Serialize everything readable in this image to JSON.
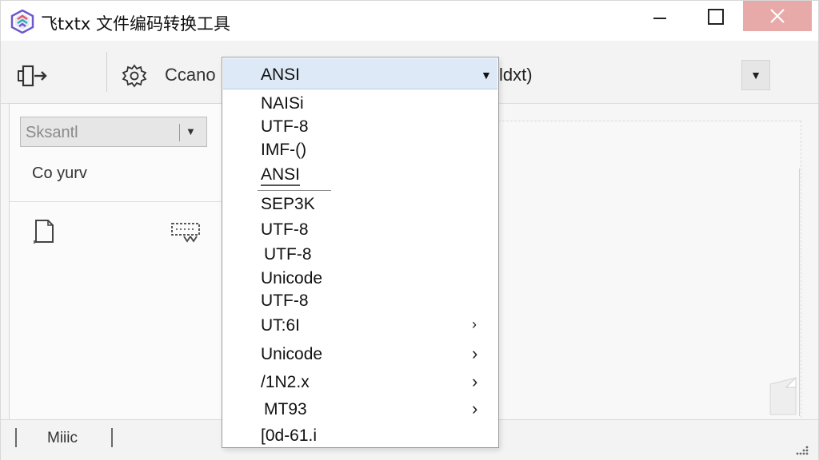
{
  "window": {
    "title": "飞txtx 文件编码转换工具"
  },
  "titlebar_buttons": {
    "minimize": "—",
    "maximize": "☐",
    "close": "✕"
  },
  "toolbar": {
    "label": "Ccano",
    "right_text": "ldxt)",
    "right_dropdown_arrow": "▼"
  },
  "left_panel": {
    "select_value": "Sksantl",
    "select_arrow": "▼",
    "text": "Co yurv"
  },
  "dropdown": {
    "selected": "ANSI",
    "arrow": "▼",
    "items": [
      {
        "label": "NAISi",
        "submenu": false
      },
      {
        "label": "UTF-8",
        "submenu": false
      },
      {
        "label": "IMF-()",
        "submenu": false
      },
      {
        "label": "ANSI",
        "submenu": false,
        "active": true
      },
      {
        "label": "SEP3K",
        "submenu": false
      },
      {
        "label": "UTF-8",
        "submenu": false
      },
      {
        "label": "UTF-8",
        "submenu": false
      },
      {
        "label": "Unicode",
        "submenu": false
      },
      {
        "label": "UTF-8",
        "submenu": false
      },
      {
        "label": "UT:6I",
        "submenu": true
      },
      {
        "label": "Unicode",
        "submenu": true
      },
      {
        "label": "/1N2.x",
        "submenu": true
      },
      {
        "label": "MT93",
        "submenu": true
      },
      {
        "label": "[0d-61.i",
        "submenu": false
      }
    ],
    "chevron": "›"
  },
  "statusbar": {
    "text": "Miiic"
  },
  "colors": {
    "accent_header": "#dde9f7",
    "close_button": "#e8a9a9",
    "icon_purple": "#6a5acd",
    "icon_teal": "#2bb3a3",
    "icon_red": "#e0566a"
  },
  "icons": {
    "app": "app-logo-icon",
    "exit": "exit-icon",
    "settings": "settings-icon",
    "document": "document-icon",
    "grid": "grid-download-icon",
    "resize": "resize-grip-icon"
  }
}
